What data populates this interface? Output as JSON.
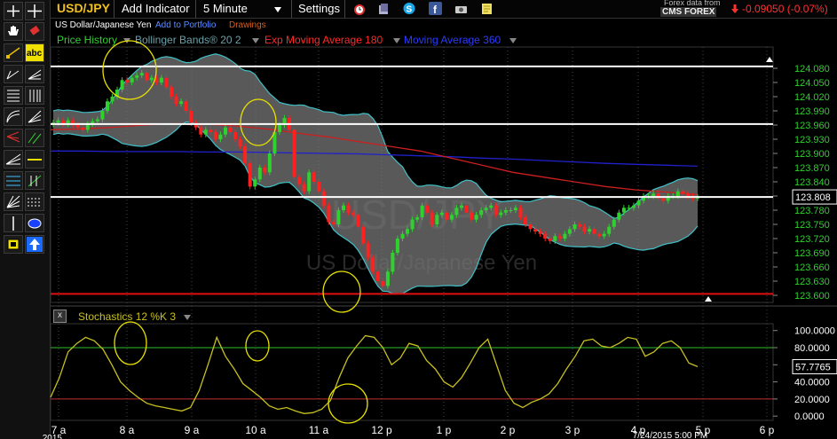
{
  "window": {
    "symbol": "USD/JPY",
    "add_indicator_label": "Add Indicator",
    "interval": "5 Minute",
    "settings_label": "Settings",
    "symbol_name": "US Dollar/Japanese Yen",
    "add_to_portfolio_label": "Add to Portfolio",
    "drawings_label": "Drawings",
    "forex_source_label": "Forex data from",
    "broker": "CMS FOREX",
    "change": "-0.09050 (-0.07%)",
    "watermark_symbol": "USD/JPY",
    "watermark_name": "US Dollar/Japanese Yen",
    "timestamp": "7/24/2015 5:00 PM",
    "year_label": "2015",
    "close_icon_label": "x"
  },
  "indicators": [
    {
      "label": "Price History",
      "color": "#2fd12f"
    },
    {
      "label": "Bollinger Bands® 20 2",
      "color": "#6aa0a8"
    },
    {
      "label": "Exp Moving Average 180",
      "color": "#ff2a2a"
    },
    {
      "label": "Moving Average 360",
      "color": "#2b3bff"
    }
  ],
  "colors": {
    "up": "#2fd12f",
    "down": "#ff2020",
    "ema": "#cc1f1f",
    "ma": "#2020cc",
    "band": "#40c0c8",
    "band_fill": "#777777",
    "stoch": "#c8c020",
    "annotation": "#e8e000",
    "axis_text": "#2fd12f"
  },
  "chart_data": {
    "type": "candlestick",
    "price_axis": {
      "ylim": [
        123.585,
        124.125
      ],
      "ticks": [
        "124.080",
        "124.050",
        "124.020",
        "123.990",
        "123.960",
        "123.930",
        "123.900",
        "123.870",
        "123.840",
        "123.810",
        "123.780",
        "123.750",
        "123.720",
        "123.690",
        "123.660",
        "123.630",
        "123.600"
      ],
      "last_price": "123.808",
      "horizontal_lines": [
        {
          "value": 124.084,
          "color": "white"
        },
        {
          "value": 123.962,
          "color": "white"
        },
        {
          "value": 123.808,
          "color": "white"
        },
        {
          "value": 123.603,
          "color": "red"
        }
      ]
    },
    "x_axis": {
      "labels": [
        "7 a",
        "8 a",
        "9 a",
        "10 a",
        "11 a",
        "12 p",
        "1 p",
        "2 p",
        "3 p",
        "4 p",
        "5 p",
        "6 p"
      ]
    },
    "price_close": [
      123.965,
      123.97,
      123.962,
      123.97,
      123.96,
      123.955,
      123.95,
      123.962,
      123.968,
      123.972,
      123.99,
      124.01,
      124.02,
      124.035,
      124.055,
      124.05,
      124.06,
      124.065,
      124.07,
      124.055,
      124.06,
      124.05,
      124.06,
      124.04,
      124.02,
      124.005,
      124.01,
      123.99,
      123.965,
      123.955,
      123.94,
      123.95,
      123.945,
      123.93,
      123.94,
      123.955,
      123.945,
      123.93,
      123.915,
      123.88,
      123.83,
      123.845,
      123.87,
      123.86,
      123.9,
      123.945,
      123.96,
      123.975,
      123.95,
      123.85,
      123.835,
      123.82,
      123.86,
      123.84,
      123.82,
      123.79,
      123.755,
      123.75,
      123.78,
      123.79,
      123.775,
      123.77,
      123.745,
      123.71,
      123.68,
      123.65,
      123.63,
      123.62,
      123.65,
      123.69,
      123.72,
      123.73,
      123.74,
      123.76,
      123.765,
      123.79,
      123.775,
      123.75,
      123.77,
      123.775,
      123.76,
      123.77,
      123.785,
      123.79,
      123.775,
      123.76,
      123.77,
      123.78,
      123.785,
      123.79,
      123.77,
      123.775,
      123.78,
      123.78,
      123.785,
      123.765,
      123.75,
      123.74,
      123.735,
      123.73,
      123.72,
      123.715,
      123.725,
      123.72,
      123.73,
      123.74,
      123.75,
      123.745,
      123.735,
      123.74,
      123.73,
      123.725,
      123.73,
      123.745,
      123.76,
      123.775,
      123.785,
      123.785,
      123.79,
      123.8,
      123.81,
      123.81,
      123.815,
      123.805,
      123.8,
      123.81,
      123.81,
      123.82,
      123.815,
      123.81,
      123.805,
      123.808
    ],
    "ema_180": [
      123.95,
      123.952,
      123.955,
      123.96,
      123.963,
      123.962,
      123.958,
      123.952,
      123.943,
      123.935,
      123.925,
      123.915,
      123.905,
      123.89,
      123.875,
      123.86,
      123.85,
      123.84,
      123.83,
      123.823,
      123.818,
      123.813
    ],
    "ma_360": [
      123.905,
      123.905,
      123.904,
      123.904,
      123.904,
      123.903,
      123.903,
      123.902,
      123.901,
      123.9,
      123.899,
      123.897,
      123.895,
      123.893,
      123.89,
      123.888,
      123.885,
      123.882,
      123.879,
      123.877,
      123.875,
      123.873
    ],
    "stochastic": {
      "label": "Stochastics 12 %K 3",
      "ylim": [
        -5,
        108
      ],
      "ticks": [
        "100.0000",
        "80.0000",
        "60.0000",
        "40.0000",
        "20.0000",
        "0.0000"
      ],
      "last_value": "57.7765",
      "overbought": 80,
      "oversold": 20,
      "values": [
        22,
        45,
        75,
        85,
        92,
        88,
        78,
        60,
        40,
        30,
        22,
        15,
        12,
        10,
        8,
        6,
        10,
        30,
        60,
        92,
        70,
        55,
        38,
        30,
        22,
        12,
        8,
        10,
        6,
        3,
        4,
        8,
        18,
        45,
        68,
        82,
        94,
        92,
        80,
        60,
        68,
        85,
        82,
        65,
        55,
        40,
        34,
        45,
        62,
        80,
        90,
        60,
        30,
        15,
        10,
        16,
        20,
        26,
        38,
        55,
        70,
        88,
        90,
        82,
        80,
        85,
        92,
        90,
        70,
        75,
        85,
        88,
        80,
        62,
        57.7765
      ]
    }
  }
}
